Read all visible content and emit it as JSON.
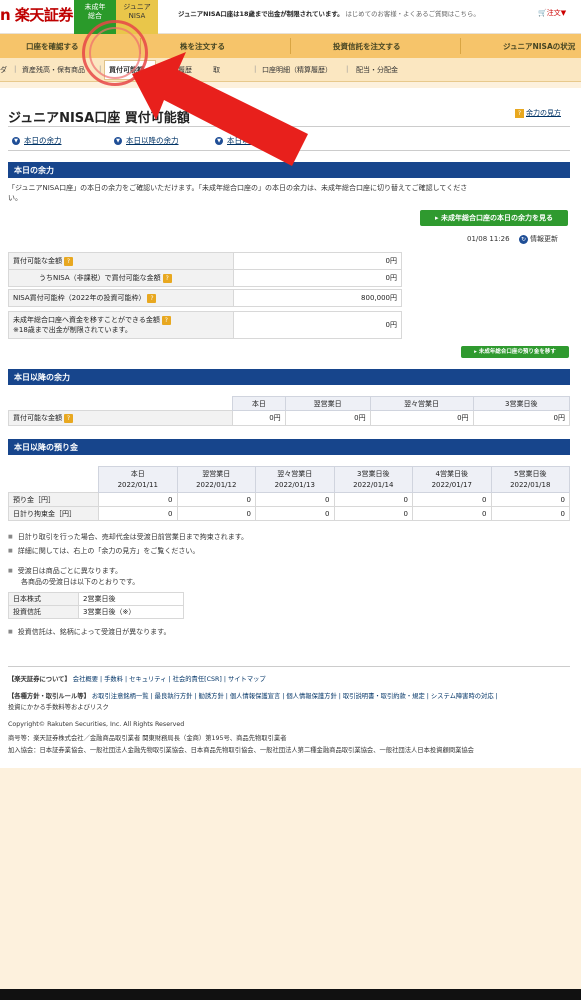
{
  "header": {
    "logo": "n 楽天証券",
    "brand_tab_1": "未成年\n総合",
    "brand_tab_2": "ジュニア\nNISA",
    "notice_bold": "ジュニアNISA口座は18歳まで出金が制限されています。",
    "notice_links": "はじめてのお客様・よくあるご質問はこちら。",
    "cart": "注文▼"
  },
  "nav": {
    "items": [
      "口座を確認する",
      "株を注文する",
      "投資信託を注文する",
      "ジュニアNISAの状況"
    ]
  },
  "subnav": {
    "items": [
      "ダ",
      "資産残高・保有商品",
      "買付可能額",
      "取引履歴",
      "取",
      "口座明細（精算履歴）",
      "配当・分配金"
    ]
  },
  "page": {
    "title": "ジュニアNISA口座 買付可能額",
    "help_link": "余力の見方"
  },
  "anchors": [
    "本日の余力",
    "本日以降の余力",
    "本日以降の預り金"
  ],
  "today": {
    "heading": "本日の余力",
    "description_1": "「ジュニアNISA口座」の本日の余力をご確認いただけます。「未成年総合口座の」の本日の余力は、未成年総合口座に切り替えてご確認してくださ",
    "description_2": "い。",
    "minor_button": "未成年総合口座の本日の余力を見る",
    "timestamp": "01/08 11:26",
    "refresh": "情報更新",
    "rows": [
      {
        "label": "買付可能な金額",
        "value": "0円"
      },
      {
        "label": "うちNISA（非課税）で買付可能な金額",
        "value": "0円"
      },
      {
        "label": "NISA買付可能枠（2022年の投資可能枠）",
        "value": "800,000円"
      },
      {
        "label": "未成年総合口座へ資金を移すことができる金額",
        "label_note": "※18歳まで出金が制限されています。",
        "value": "0円"
      }
    ],
    "minor_transfer_button": "未成年総合口座の預り金を移す"
  },
  "future": {
    "heading": "本日以降の余力",
    "columns": [
      "本日",
      "翌営業日",
      "翌々営業日",
      "3営業日後"
    ],
    "row_label": "買付可能な金額",
    "values": [
      "0円",
      "0円",
      "0円",
      "0円"
    ]
  },
  "deposits": {
    "heading": "本日以降の預り金",
    "columns": [
      {
        "day": "本日",
        "date": "2022/01/11"
      },
      {
        "day": "翌営業日",
        "date": "2022/01/12"
      },
      {
        "day": "翌々営業日",
        "date": "2022/01/13"
      },
      {
        "day": "3営業日後",
        "date": "2022/01/14"
      },
      {
        "day": "4営業日後",
        "date": "2022/01/17"
      },
      {
        "day": "5営業日後",
        "date": "2022/01/18"
      }
    ],
    "rows": [
      {
        "label": "預り金［円］",
        "values": [
          "0",
          "0",
          "0",
          "0",
          "0",
          "0"
        ]
      },
      {
        "label": "日計り拘束金［円］",
        "values": [
          "0",
          "0",
          "0",
          "0",
          "0",
          "0"
        ]
      }
    ]
  },
  "notes": {
    "n1": "日計り取引を行った場合、売却代金は受渡日前営業日まで拘束されます。",
    "n2": "詳細に関しては、右上の「余力の見方」をご覧ください。",
    "n3a": "受渡日は商品ごとに異なります。",
    "n3b": "各商品の受渡日は以下のとおりです。",
    "settlement": [
      {
        "product": "日本株式",
        "days": "2営業日後"
      },
      {
        "product": "投資信託",
        "days": "3営業日後（※）"
      }
    ],
    "n4": "投資信託は、銘柄によって受渡日が異なります。"
  },
  "footer": {
    "about_label": "【楽天証券について】",
    "about_links": "会社概要 | 手数料 | セキュリティ | 社会的責任[CSR] | サイトマップ",
    "policy_label": "【各種方針・取引ルール等】",
    "policy_links": "お取引注意銘柄一覧 | 最良執行方針 | 勧誘方針 | 個人情報保護宣言 | 個人情報保護方針 | 取引説明書・取引約款・規定 | システム障害時の対応 |",
    "policy_links_2": "投資にかかる手数料等およびリスク",
    "copyright": "Copyright© Rakuten Securities, Inc. All Rights Reserved",
    "registration": "商号等：楽天証券株式会社／金融商品取引業者 関東財務局長（金商）第195号、商品先物取引業者",
    "associations": "加入協会：日本証券業協会、一般社団法人金融先物取引業協会、日本商品先物取引協会、一般社団法人第二種金融商品取引業協会、一般社団法人日本投資顧問業協会"
  },
  "colors": {
    "section_bar": "#17458c",
    "nav_bar": "#f6c46a",
    "green_button": "#2f9a2f",
    "brand_red": "#bf0000",
    "annotation_red": "#e8201c"
  }
}
